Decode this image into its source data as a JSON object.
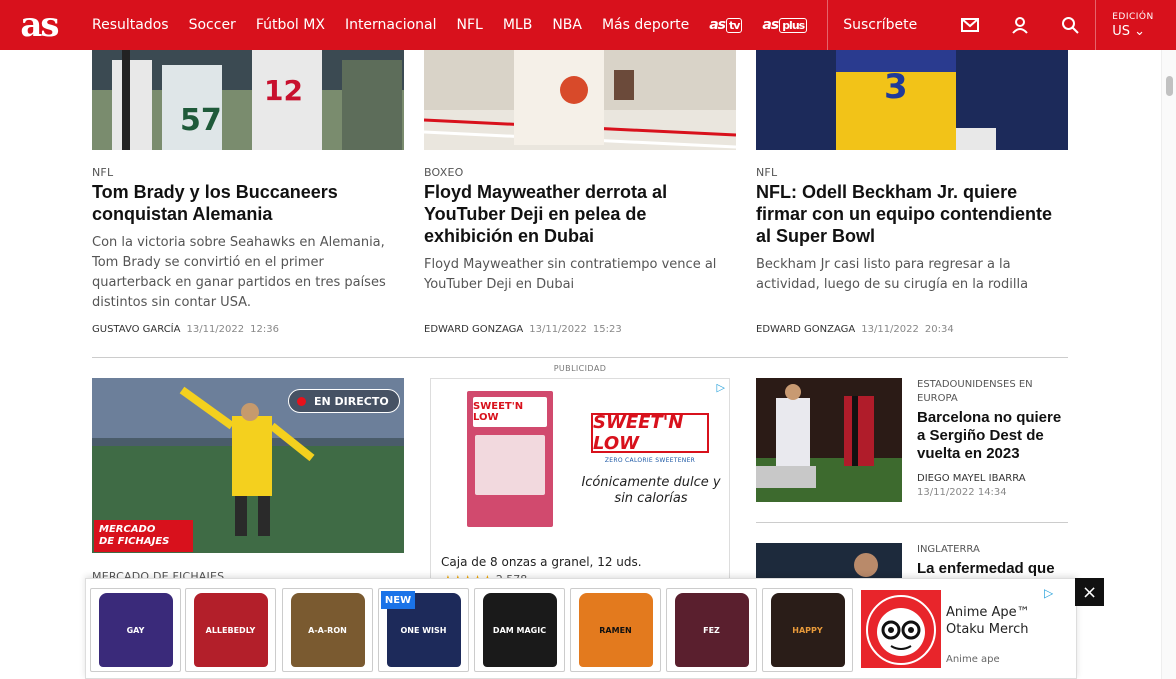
{
  "nav": {
    "logo": "as",
    "items": [
      "Resultados",
      "Soccer",
      "Fútbol MX",
      "Internacional",
      "NFL",
      "MLB",
      "NBA",
      "Más deporte"
    ],
    "brand_tv": "as",
    "brand_tv_badge": "tv",
    "brand_plus": "as",
    "brand_plus_badge": "plus",
    "subscribe": "Suscríbete",
    "edition_label": "EDICIÓN",
    "edition_value": "US"
  },
  "top_articles": [
    {
      "section": "NFL",
      "headline": "Tom Brady y los Buccaneers conquistan Alemania",
      "summary": "Con la victoria sobre Seahawks en Alemania, Tom Brady se convirtió en el primer quarterback en ganar partidos en tres países distintos sin contar USA.",
      "author": "GUSTAVO GARCÍA",
      "date": "13/11/2022",
      "time": "12:36"
    },
    {
      "section": "BOXEO",
      "headline": "Floyd Mayweather derrota al YouTuber Deji en pelea de exhibición en Dubai",
      "summary": "Floyd Mayweather sin contratiempo vence al YouTuber Deji en Dubai",
      "author": "EDWARD GONZAGA",
      "date": "13/11/2022",
      "time": "15:23"
    },
    {
      "section": "NFL",
      "headline": "NFL: Odell Beckham Jr. quiere firmar con un equipo contendiente al Super Bowl",
      "summary": "Beckham Jr casi listo para regresar a la actividad, luego de su cirugía en la rodilla",
      "author": "EDWARD GONZAGA",
      "date": "13/11/2022",
      "time": "20:34"
    }
  ],
  "live": {
    "badge": "EN DIRECTO",
    "overlay_line1": "MERCADO",
    "overlay_line2": "DE FICHAJES",
    "section": "MERCADO DE FICHAJES"
  },
  "ad": {
    "label": "PUBLICIDAD",
    "brand_box": "SWEET'N LOW",
    "brand_logo": "SWEET'N LOW",
    "brand_sub": "ZERO CALORIE SWEETENER",
    "tagline": "Icónicamente dulce y sin calorías",
    "caption": "Caja de 8 onzas a granel, 12 uds.",
    "rating_stars": "★★★★★",
    "rating_count": "2,578"
  },
  "side_articles": [
    {
      "section": "ESTADOUNIDENSES EN EUROPA",
      "headline": "Barcelona no quiere a Sergiño Dest de vuelta en 2023",
      "author": "DIEGO MAYEL IBARRA",
      "date": "13/11/2022",
      "time": "14:34"
    },
    {
      "section": "INGLATERRA",
      "headline": "La enfermedad que"
    }
  ],
  "bottom_ad": {
    "new_badge": "NEW",
    "sweaters": [
      "GAY",
      "ALLEBEDLY",
      "A-A-RON",
      "ONE WISH",
      "DAM MAGIC",
      "RAMEN",
      "FEZ",
      "HAPPY"
    ],
    "anime_title": "Anime Ape™ Otaku Merch",
    "anime_source": "Anime ape",
    "close": "×"
  },
  "colors": {
    "brand_red": "#d8111c",
    "link_blue": "#26a0da"
  }
}
